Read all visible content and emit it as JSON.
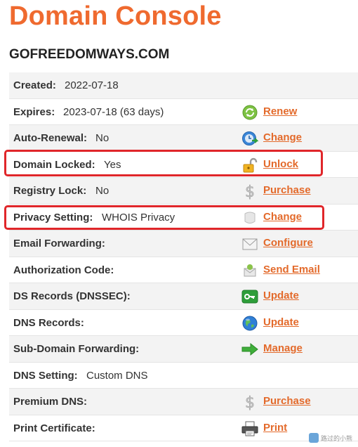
{
  "page": {
    "title": "Domain Console",
    "domain": "GOFREEDOMWAYS.COM"
  },
  "colors": {
    "accent": "#ef6a2f",
    "link": "#e36a2b",
    "highlight": "#e0262a"
  },
  "rows": [
    {
      "label": "Created:",
      "value": "2022-07-18",
      "icon": "",
      "action": ""
    },
    {
      "label": "Expires:",
      "value": "2023-07-18 (63 days)",
      "icon": "renew-icon",
      "action": "Renew"
    },
    {
      "label": "Auto-Renewal:",
      "value": "No",
      "icon": "clock-change-icon",
      "action": "Change"
    },
    {
      "label": "Domain Locked:",
      "value": "Yes",
      "icon": "padlock-icon",
      "action": "Unlock"
    },
    {
      "label": "Registry Lock:",
      "value": "No",
      "icon": "dollar-icon",
      "action": "Purchase"
    },
    {
      "label": "Privacy Setting:",
      "value": "WHOIS Privacy",
      "icon": "privacy-icon",
      "action": "Change"
    },
    {
      "label": "Email Forwarding:",
      "value": "",
      "icon": "envelope-icon",
      "action": "Configure"
    },
    {
      "label": "Authorization Code:",
      "value": "",
      "icon": "send-email-icon",
      "action": "Send Email"
    },
    {
      "label": "DS Records (DNSSEC):",
      "value": "",
      "icon": "key-icon",
      "action": "Update"
    },
    {
      "label": "DNS Records:",
      "value": "",
      "icon": "globe-icon",
      "action": "Update"
    },
    {
      "label": "Sub-Domain Forwarding:",
      "value": "",
      "icon": "arrow-right-icon",
      "action": "Manage"
    },
    {
      "label": "DNS Setting:",
      "value": "Custom DNS",
      "icon": "",
      "action": ""
    },
    {
      "label": "Premium DNS:",
      "value": "",
      "icon": "dollar-icon",
      "action": "Purchase"
    },
    {
      "label": "Print Certificate:",
      "value": "",
      "icon": "printer-icon",
      "action": "Print"
    }
  ],
  "watermark": {
    "text": "路过的小熊"
  }
}
